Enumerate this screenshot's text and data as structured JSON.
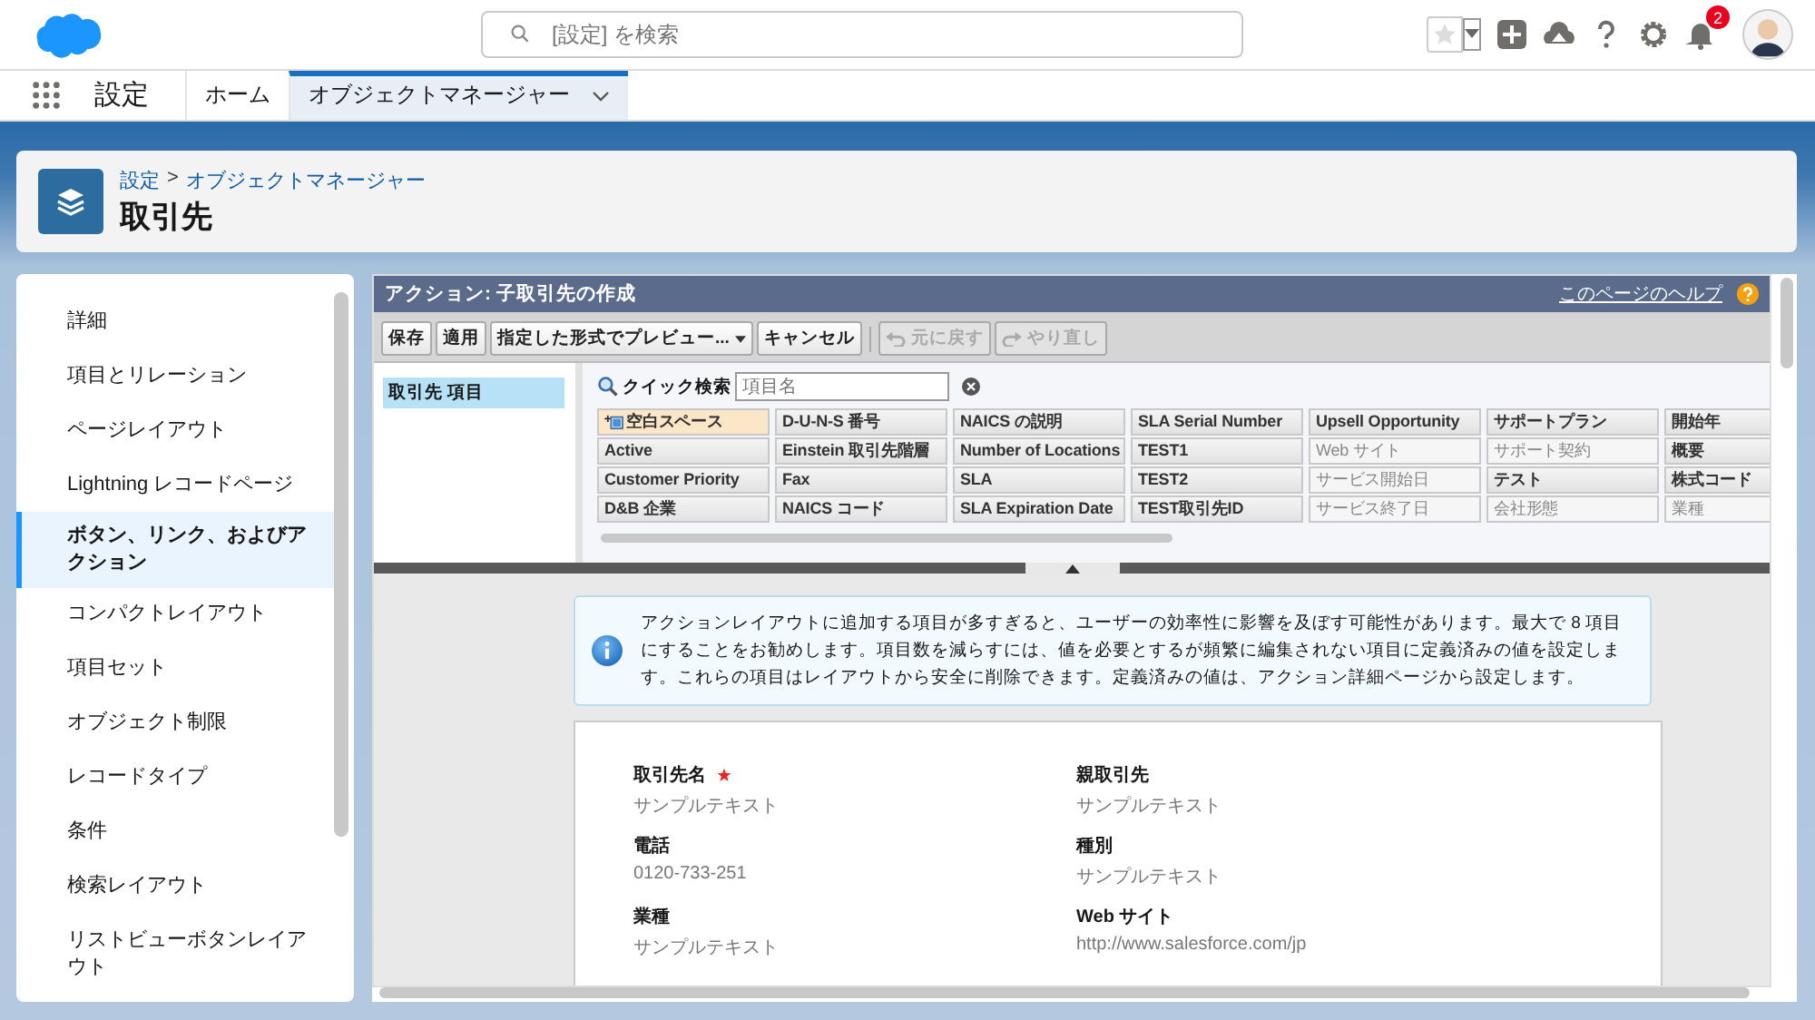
{
  "header": {
    "search": {
      "placeholder": "[設定] を検索"
    },
    "notification_count": "2"
  },
  "nav": {
    "app_name": "設定",
    "tabs": [
      {
        "label": "ホーム",
        "selected": false,
        "menu": false
      },
      {
        "label": "オブジェクトマネージャー",
        "selected": true,
        "menu": true
      }
    ]
  },
  "page_header": {
    "breadcrumb": [
      "設定",
      "オブジェクトマネージャー"
    ],
    "separator": ">",
    "title": "取引先"
  },
  "sidebar": {
    "items": [
      {
        "label": "詳細",
        "selected": false
      },
      {
        "label": "項目とリレーション",
        "selected": false
      },
      {
        "label": "ページレイアウト",
        "selected": false
      },
      {
        "label": "Lightning レコードページ",
        "selected": false
      },
      {
        "label": "ボタン、リンク、およびアクション",
        "selected": true
      },
      {
        "label": "コンパクトレイアウト",
        "selected": false
      },
      {
        "label": "項目セット",
        "selected": false
      },
      {
        "label": "オブジェクト制限",
        "selected": false
      },
      {
        "label": "レコードタイプ",
        "selected": false
      },
      {
        "label": "条件",
        "selected": false
      },
      {
        "label": "検索レイアウト",
        "selected": false
      },
      {
        "label": "リストビューボタンレイアウト",
        "selected": false
      }
    ]
  },
  "editor": {
    "title": "アクション: 子取引先の作成",
    "help_link": "このページのヘルプ",
    "toolbar": [
      {
        "label": "保存",
        "disabled": false,
        "kind": "button"
      },
      {
        "label": "適用",
        "disabled": false,
        "kind": "button"
      },
      {
        "label": "指定した形式でプレビュー...",
        "disabled": false,
        "kind": "dropdown"
      },
      {
        "label": "キャンセル",
        "disabled": false,
        "kind": "button"
      },
      {
        "label": "元に戻す",
        "disabled": true,
        "kind": "undo"
      },
      {
        "label": "やり直し",
        "disabled": true,
        "kind": "redo"
      }
    ],
    "categories": [
      {
        "label": "取引先 項目",
        "selected": true
      }
    ],
    "quick_search": {
      "label": "クイック検索",
      "placeholder": "項目名"
    },
    "palette": [
      {
        "label": "空白スペース",
        "kind": "blank",
        "used": false
      },
      {
        "label": "D-U-N-S 番号",
        "kind": "field",
        "used": false
      },
      {
        "label": "NAICS の説明",
        "kind": "field",
        "used": false
      },
      {
        "label": "SLA Serial Number",
        "kind": "field",
        "used": false
      },
      {
        "label": "Upsell Opportunity",
        "kind": "field",
        "used": false
      },
      {
        "label": "サポートプラン",
        "kind": "field",
        "used": false
      },
      {
        "label": "開始年",
        "kind": "field",
        "used": false
      },
      {
        "label": "Active",
        "kind": "field",
        "used": false
      },
      {
        "label": "Einstein 取引先階層",
        "kind": "field",
        "used": false
      },
      {
        "label": "Number of Locations",
        "kind": "field",
        "used": false
      },
      {
        "label": "TEST1",
        "kind": "field",
        "used": false
      },
      {
        "label": "Web サイト",
        "kind": "field",
        "used": true
      },
      {
        "label": "サポート契約",
        "kind": "field",
        "used": true
      },
      {
        "label": "概要",
        "kind": "field",
        "used": false
      },
      {
        "label": "Customer Priority",
        "kind": "field",
        "used": false
      },
      {
        "label": "Fax",
        "kind": "field",
        "used": false
      },
      {
        "label": "SLA",
        "kind": "field",
        "used": false
      },
      {
        "label": "TEST2",
        "kind": "field",
        "used": false
      },
      {
        "label": "サービス開始日",
        "kind": "field",
        "used": true
      },
      {
        "label": "テスト",
        "kind": "field",
        "used": false
      },
      {
        "label": "株式コード",
        "kind": "field",
        "used": false
      },
      {
        "label": "D&B 企業",
        "kind": "field",
        "used": false
      },
      {
        "label": "NAICS コード",
        "kind": "field",
        "used": false
      },
      {
        "label": "SLA Expiration Date",
        "kind": "field",
        "used": false
      },
      {
        "label": "TEST取引先ID",
        "kind": "field",
        "used": false
      },
      {
        "label": "サービス終了日",
        "kind": "field",
        "used": true
      },
      {
        "label": "会社形態",
        "kind": "field",
        "used": true
      },
      {
        "label": "業種",
        "kind": "field",
        "used": true
      }
    ],
    "info_message": "アクションレイアウトに追加する項目が多すぎると、ユーザーの効率性に影響を及ぼす可能性があります。最大で 8 項目にすることをお勧めします。項目数を減らすには、値を必要とするが頻繁に編集されない項目に定義済みの値を設定します。これらの項目はレイアウトから安全に削除できます。定義済みの値は、アクション詳細ページから設定します。",
    "form_fields": [
      {
        "label": "取引先名",
        "value": "サンプルテキスト",
        "required": true
      },
      {
        "label": "親取引先",
        "value": "サンプルテキスト",
        "required": false
      },
      {
        "label": "電話",
        "value": "0120-733-251",
        "required": false
      },
      {
        "label": "種別",
        "value": "サンプルテキスト",
        "required": false
      },
      {
        "label": "業種",
        "value": "サンプルテキスト",
        "required": false
      },
      {
        "label": "Web サイト",
        "value": "http://www.salesforce.com/jp",
        "required": false
      }
    ]
  }
}
